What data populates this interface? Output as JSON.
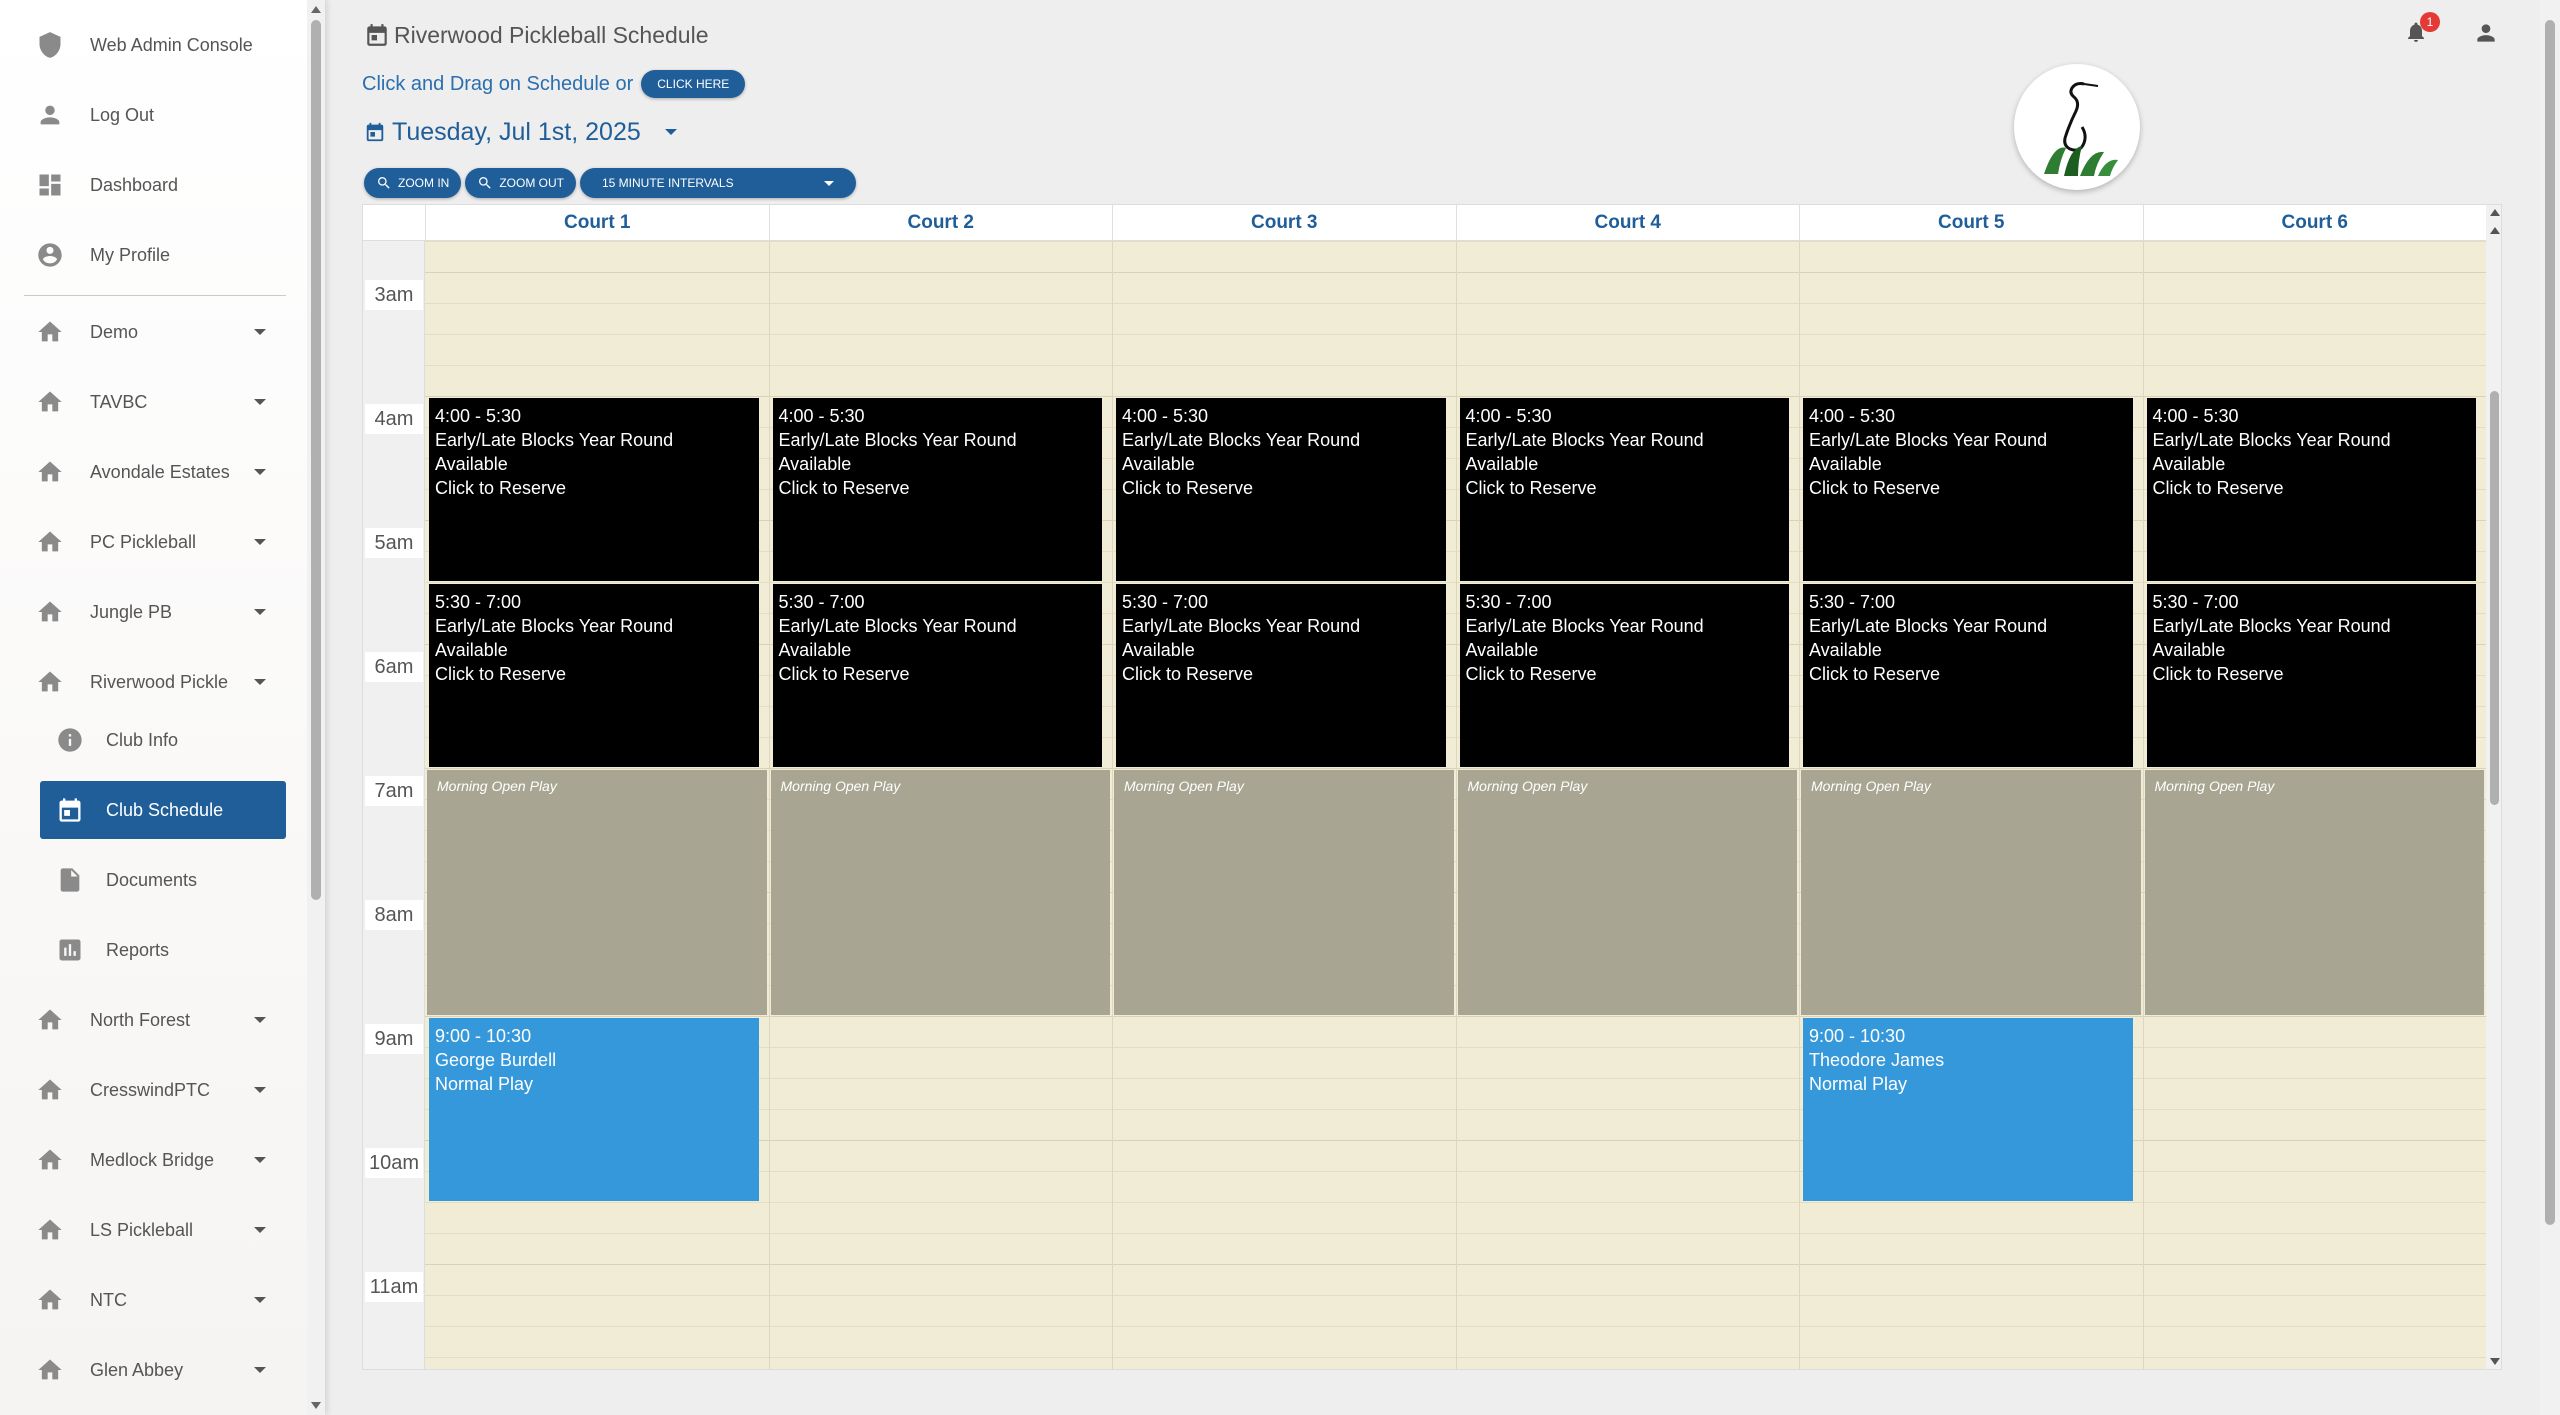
{
  "sidebar": {
    "items": [
      {
        "label": "Web Admin Console",
        "icon": "admin-shield-icon"
      },
      {
        "label": "Log Out",
        "icon": "person-icon"
      },
      {
        "label": "Dashboard",
        "icon": "dashboard-icon"
      },
      {
        "label": "My Profile",
        "icon": "account-circle-icon"
      },
      {
        "label": "Demo",
        "icon": "home-icon",
        "expandable": true
      },
      {
        "label": "TAVBC",
        "icon": "home-icon",
        "expandable": true
      },
      {
        "label": "Avondale Estates",
        "icon": "home-icon",
        "expandable": true
      },
      {
        "label": "PC Pickleball",
        "icon": "home-icon",
        "expandable": true
      },
      {
        "label": "Jungle PB",
        "icon": "home-icon",
        "expandable": true
      },
      {
        "label": "Riverwood Pickle",
        "icon": "home-icon",
        "expandable": true
      },
      {
        "label": "Club Info",
        "icon": "info-icon",
        "sub": true
      },
      {
        "label": "Club Schedule",
        "icon": "calendar-icon",
        "sub": true,
        "active": true
      },
      {
        "label": "Documents",
        "icon": "document-icon",
        "sub": true
      },
      {
        "label": "Reports",
        "icon": "chart-icon",
        "sub": true
      },
      {
        "label": "North Forest",
        "icon": "home-icon",
        "expandable": true
      },
      {
        "label": "CresswindPTC",
        "icon": "home-icon",
        "expandable": true
      },
      {
        "label": "Medlock Bridge",
        "icon": "home-icon",
        "expandable": true
      },
      {
        "label": "LS Pickleball",
        "icon": "home-icon",
        "expandable": true
      },
      {
        "label": "NTC",
        "icon": "home-icon",
        "expandable": true
      },
      {
        "label": "Glen Abbey",
        "icon": "home-icon",
        "expandable": true
      }
    ]
  },
  "header": {
    "title": "Riverwood Pickleball Schedule",
    "drag_hint": "Click and Drag on Schedule or",
    "click_here": "CLICK HERE",
    "date": "Tuesday, Jul 1st, 2025",
    "zoom_in": "ZOOM IN",
    "zoom_out": "ZOOM OUT",
    "interval": "15 MINUTE INTERVALS",
    "notification_count": "1"
  },
  "calendar": {
    "courts": [
      "Court 1",
      "Court 2",
      "Court 3",
      "Court 4",
      "Court 5",
      "Court 6"
    ],
    "time_labels": [
      "3am",
      "4am",
      "5am",
      "6am",
      "7am",
      "8am",
      "9am",
      "10am",
      "11am"
    ],
    "first_visible_hour": 2.75,
    "events": [
      {
        "court": 0,
        "start": 4.0,
        "end": 5.5,
        "style": "black",
        "lines": [
          "4:00 - 5:30",
          "Early/Late Blocks Year Round",
          "Available",
          "Click to Reserve"
        ]
      },
      {
        "court": 1,
        "start": 4.0,
        "end": 5.5,
        "style": "black",
        "lines": [
          "4:00 - 5:30",
          "Early/Late Blocks Year Round",
          "Available",
          "Click to Reserve"
        ]
      },
      {
        "court": 2,
        "start": 4.0,
        "end": 5.5,
        "style": "black",
        "lines": [
          "4:00 - 5:30",
          "Early/Late Blocks Year Round",
          "Available",
          "Click to Reserve"
        ]
      },
      {
        "court": 3,
        "start": 4.0,
        "end": 5.5,
        "style": "black",
        "lines": [
          "4:00 - 5:30",
          "Early/Late Blocks Year Round",
          "Available",
          "Click to Reserve"
        ]
      },
      {
        "court": 4,
        "start": 4.0,
        "end": 5.5,
        "style": "black",
        "lines": [
          "4:00 - 5:30",
          "Early/Late Blocks Year Round",
          "Available",
          "Click to Reserve"
        ]
      },
      {
        "court": 5,
        "start": 4.0,
        "end": 5.5,
        "style": "black",
        "lines": [
          "4:00 - 5:30",
          "Early/Late Blocks Year Round",
          "Available",
          "Click to Reserve"
        ]
      },
      {
        "court": 0,
        "start": 5.5,
        "end": 7.0,
        "style": "black",
        "lines": [
          "5:30 - 7:00",
          "Early/Late Blocks Year Round",
          "Available",
          "Click to Reserve"
        ]
      },
      {
        "court": 1,
        "start": 5.5,
        "end": 7.0,
        "style": "black",
        "lines": [
          "5:30 - 7:00",
          "Early/Late Blocks Year Round",
          "Available",
          "Click to Reserve"
        ]
      },
      {
        "court": 2,
        "start": 5.5,
        "end": 7.0,
        "style": "black",
        "lines": [
          "5:30 - 7:00",
          "Early/Late Blocks Year Round",
          "Available",
          "Click to Reserve"
        ]
      },
      {
        "court": 3,
        "start": 5.5,
        "end": 7.0,
        "style": "black",
        "lines": [
          "5:30 - 7:00",
          "Early/Late Blocks Year Round",
          "Available",
          "Click to Reserve"
        ]
      },
      {
        "court": 4,
        "start": 5.5,
        "end": 7.0,
        "style": "black",
        "lines": [
          "5:30 - 7:00",
          "Early/Late Blocks Year Round",
          "Available",
          "Click to Reserve"
        ]
      },
      {
        "court": 5,
        "start": 5.5,
        "end": 7.0,
        "style": "black",
        "lines": [
          "5:30 - 7:00",
          "Early/Late Blocks Year Round",
          "Available",
          "Click to Reserve"
        ]
      },
      {
        "court": 0,
        "start": 7.0,
        "end": 9.0,
        "style": "gray",
        "lines": [
          "Morning Open Play"
        ]
      },
      {
        "court": 1,
        "start": 7.0,
        "end": 9.0,
        "style": "gray",
        "lines": [
          "Morning Open Play"
        ]
      },
      {
        "court": 2,
        "start": 7.0,
        "end": 9.0,
        "style": "gray",
        "lines": [
          "Morning Open Play"
        ]
      },
      {
        "court": 3,
        "start": 7.0,
        "end": 9.0,
        "style": "gray",
        "lines": [
          "Morning Open Play"
        ]
      },
      {
        "court": 4,
        "start": 7.0,
        "end": 9.0,
        "style": "gray",
        "lines": [
          "Morning Open Play"
        ]
      },
      {
        "court": 5,
        "start": 7.0,
        "end": 9.0,
        "style": "gray",
        "lines": [
          "Morning Open Play"
        ]
      },
      {
        "court": 0,
        "start": 9.0,
        "end": 10.5,
        "style": "blue",
        "lines": [
          "9:00 - 10:30",
          "George Burdell",
          "Normal Play"
        ]
      },
      {
        "court": 4,
        "start": 9.0,
        "end": 10.5,
        "style": "blue",
        "lines": [
          "9:00 - 10:30",
          "Theodore James",
          "Normal Play"
        ]
      }
    ]
  },
  "colors": {
    "accent": "#1f5e99",
    "event_black": "#000000",
    "event_blue": "#3498db",
    "event_gray": "#a8a692",
    "calendar_bg": "#f1ecd6"
  }
}
